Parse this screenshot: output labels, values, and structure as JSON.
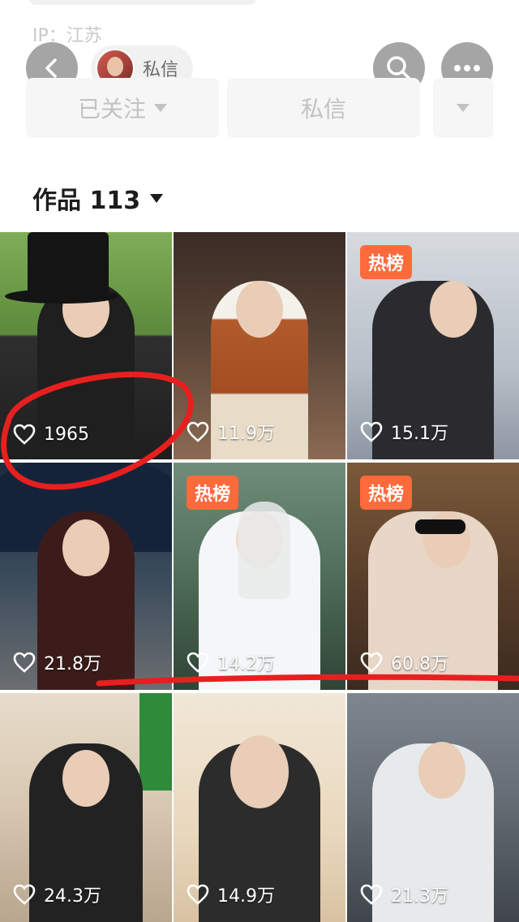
{
  "header": {
    "ip_label": "IP：江苏",
    "chip_label": "私信",
    "follow_label": "已关注",
    "message_label": "私信",
    "works_label": "作品 113"
  },
  "grid": {
    "items": [
      {
        "likes": "1965",
        "badge": ""
      },
      {
        "likes": "11.9万",
        "badge": ""
      },
      {
        "likes": "15.1万",
        "badge": "热榜"
      },
      {
        "likes": "21.8万",
        "badge": ""
      },
      {
        "likes": "14.2万",
        "badge": "热榜"
      },
      {
        "likes": "60.8万",
        "badge": "热榜"
      },
      {
        "likes": "24.3万",
        "badge": ""
      },
      {
        "likes": "14.9万",
        "badge": ""
      },
      {
        "likes": "21.3万",
        "badge": ""
      }
    ]
  },
  "colors": {
    "accent": "#ff6a3d",
    "annotation_red": "#e81f1f"
  }
}
